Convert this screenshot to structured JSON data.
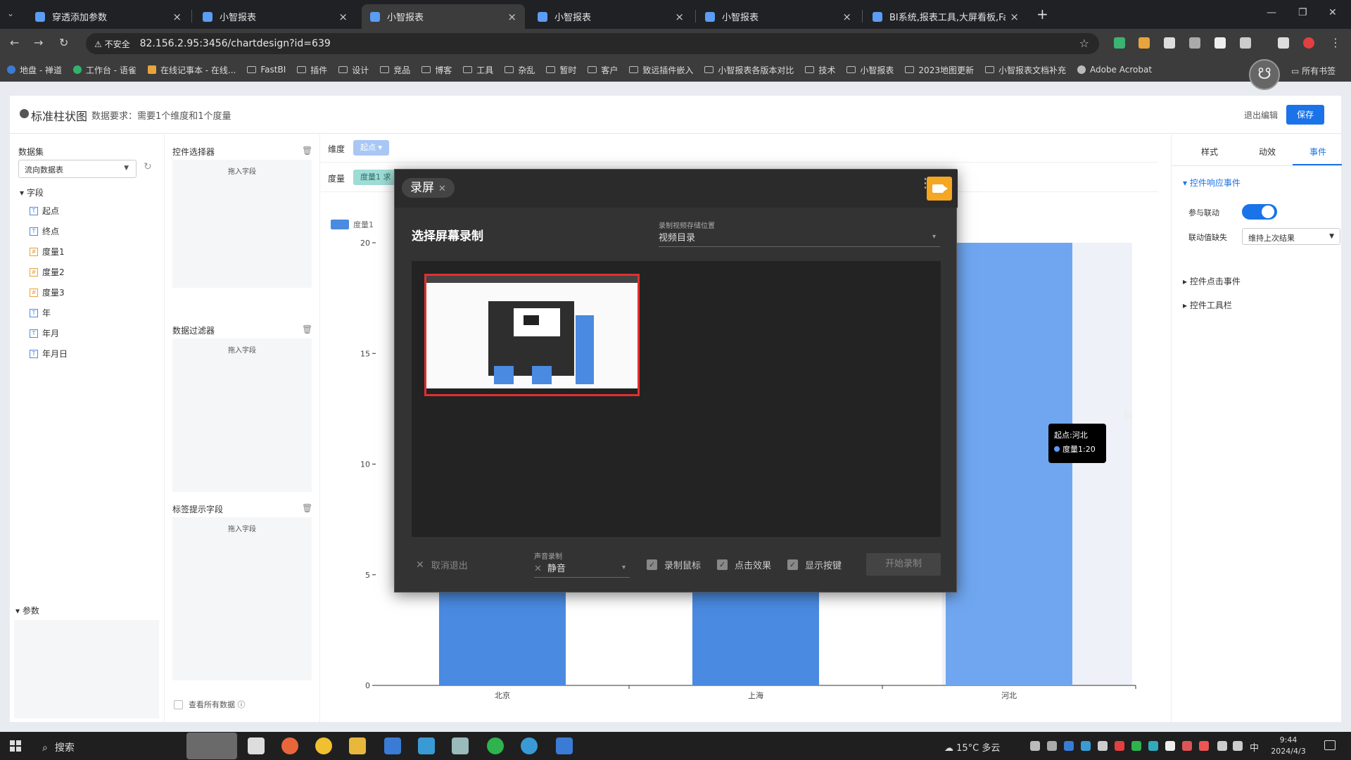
{
  "browser": {
    "tabs": [
      {
        "title": "穿透添加参数",
        "active": false
      },
      {
        "title": "小智报表",
        "active": false
      },
      {
        "title": "小智报表",
        "active": true
      },
      {
        "title": "小智报表",
        "active": false
      },
      {
        "title": "小智报表",
        "active": false
      },
      {
        "title": "BI系统,报表工具,大屏看板,FastI",
        "active": false
      }
    ],
    "security_label": "不安全",
    "url": "82.156.2.95:3456/chartdesign?id=639",
    "bookmarks": [
      {
        "label": "地盘 - 禅道",
        "icon": "globe-icon"
      },
      {
        "label": "工作台 - 语雀",
        "icon": "circle-icon"
      },
      {
        "label": "在线记事本 - 在线...",
        "icon": "note-icon"
      },
      {
        "label": "FastBI",
        "icon": "folder-icon"
      },
      {
        "label": "插件",
        "icon": "folder-icon"
      },
      {
        "label": "设计",
        "icon": "folder-icon"
      },
      {
        "label": "竞品",
        "icon": "folder-icon"
      },
      {
        "label": "博客",
        "icon": "folder-icon"
      },
      {
        "label": "工具",
        "icon": "folder-icon"
      },
      {
        "label": "杂乱",
        "icon": "folder-icon"
      },
      {
        "label": "暂时",
        "icon": "folder-icon"
      },
      {
        "label": "客户",
        "icon": "folder-icon"
      },
      {
        "label": "致远插件嵌入",
        "icon": "folder-icon"
      },
      {
        "label": "小智报表各版本对比",
        "icon": "folder-icon"
      },
      {
        "label": "技术",
        "icon": "folder-icon"
      },
      {
        "label": "小智报表",
        "icon": "folder-icon"
      },
      {
        "label": "2023地图更新",
        "icon": "folder-icon"
      },
      {
        "label": "小智报表文档补充",
        "icon": "folder-icon"
      },
      {
        "label": "Adobe Acrobat",
        "icon": "acrobat-icon"
      }
    ],
    "all_bookmarks": "所有书签"
  },
  "app": {
    "title": "标准柱状图",
    "requirement": "数据要求：需要1个维度和1个度量",
    "exit_edit": "退出编辑",
    "save": "保存"
  },
  "dataset_panel": {
    "label": "数据集",
    "selected": "流向数据表",
    "fields_header": "字段",
    "fields": [
      {
        "name": "起点",
        "kind": "dim"
      },
      {
        "name": "终点",
        "kind": "dim"
      },
      {
        "name": "度量1",
        "kind": "measure"
      },
      {
        "name": "度量2",
        "kind": "measure"
      },
      {
        "name": "度量3",
        "kind": "measure"
      },
      {
        "name": "年",
        "kind": "dim"
      },
      {
        "name": "年月",
        "kind": "dim"
      },
      {
        "name": "年月日",
        "kind": "dim"
      }
    ],
    "params_header": "参数"
  },
  "control_panel": {
    "sections": [
      {
        "label": "控件选择器",
        "drop": "拖入字段"
      },
      {
        "label": "数据过滤器",
        "drop": "拖入字段"
      },
      {
        "label": "标签提示字段",
        "drop": "拖入字段"
      }
    ],
    "show_all": "查看所有数据"
  },
  "shelves": {
    "dimension_label": "维度",
    "dimension_pill": "起点",
    "measure_label": "度量",
    "measure_pill": "度量1 求"
  },
  "chart_data": {
    "type": "bar",
    "categories": [
      "北京",
      "上海",
      "河北"
    ],
    "series": [
      {
        "name": "度量1",
        "values": [
          5.4,
          5.4,
          20
        ]
      }
    ],
    "ylim": [
      0,
      20
    ],
    "yticks": [
      0,
      5,
      10,
      15,
      20
    ],
    "legend": "top-left",
    "color": "#4a8ae0",
    "highlight_color": "#6fa6ef",
    "hovered_category": "河北"
  },
  "tooltip": {
    "line1": "起点:河北",
    "line2": "度量1:20"
  },
  "props_panel": {
    "tabs": [
      "样式",
      "动效",
      "事件"
    ],
    "active_tab": "事件",
    "response_section": "控件响应事件",
    "linkage_label": "参与联动",
    "linkage_on": true,
    "missing_label": "联动值缺失",
    "missing_value": "维持上次结果",
    "click_section": "控件点击事件",
    "toolbar_section": "控件工具栏"
  },
  "recorder": {
    "tab": "录屏",
    "title": "选择屏幕录制",
    "save_location_label": "录制视频存储位置",
    "save_location": "视频目录",
    "cancel": "取消退出",
    "audio_label": "声音录制",
    "audio_value": "静音",
    "options": [
      {
        "label": "录制鼠标",
        "checked": true
      },
      {
        "label": "点击效果",
        "checked": true
      },
      {
        "label": "显示按键",
        "checked": true
      }
    ],
    "start": "开始录制"
  },
  "taskbar": {
    "search": "搜索",
    "weather": "15°C 多云",
    "ime": "中",
    "time": "9:44",
    "date": "2024/4/3"
  }
}
